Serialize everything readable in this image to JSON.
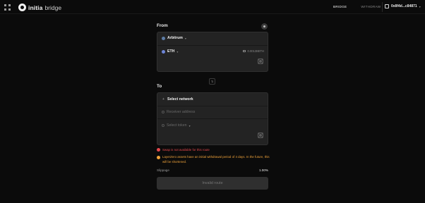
{
  "header": {
    "logo_text": "initia",
    "logo_sub": "bridge",
    "tabs": [
      {
        "label": "BRIDGE",
        "active": true
      },
      {
        "label": "WITHDRAW",
        "active": false
      }
    ],
    "wallet_address": "0x8f4d...c84871"
  },
  "from": {
    "section_label": "From",
    "chain": "Arbitrum",
    "asset": "ETH",
    "balance": "0.00138ETH"
  },
  "to": {
    "section_label": "To",
    "network_placeholder": "Select network",
    "address_placeholder": "Receiver address",
    "asset_placeholder": "Select token"
  },
  "messages": {
    "error": "Swap is not available for this route",
    "warning": "LayerZero assets have an initial withdrawal period of 4 days. In the future, this will be shortened."
  },
  "slippage": {
    "label": "Slippage",
    "value": "1.00%"
  },
  "submit": {
    "label": "Invalid route"
  },
  "colors": {
    "background": "#0b0b0b",
    "card": "#232323",
    "error": "#e5484d",
    "warning": "#f0a33a"
  }
}
